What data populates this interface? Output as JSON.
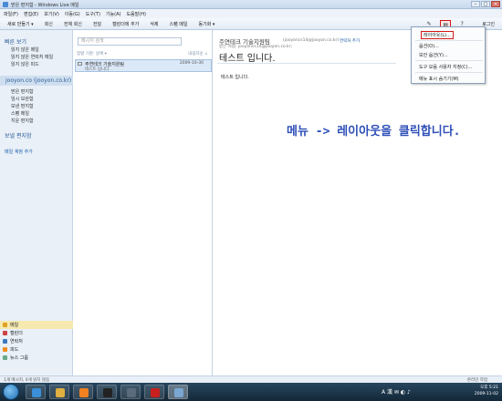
{
  "window": {
    "title": "받은 편지함 - Windows Live 메일",
    "controls": [
      "–",
      "□",
      "✕"
    ]
  },
  "menu": [
    "파일(F)",
    "편집(E)",
    "보기(V)",
    "이동(G)",
    "도구(T)",
    "기능(A)",
    "도움말(H)"
  ],
  "toolbar": {
    "items": [
      "새로 만들기 ▾",
      "회신",
      "전체 회신",
      "전달",
      "캘린더에 추가",
      "삭제",
      "스팸 메일",
      "동기화 ▾"
    ],
    "right": {
      "pen_icon": "✎",
      "layout_icon": "▤",
      "help_icon": "?",
      "login_label": "로그인"
    }
  },
  "sidebar": {
    "quick_view_header": "빠른 보기",
    "quick_items": [
      "읽지 않은 메일",
      "읽지 않은 연락처 메일",
      "읽지 않은 피드"
    ],
    "account": "jooyon.co (jooyon.co.kr)",
    "folders": [
      "받은 편지함",
      "임시 보관함",
      "보낸 편지함",
      "스팸 메일",
      "지운 편지함"
    ],
    "outbox": "보낼 편지함",
    "add_account": "메일 계정 추가",
    "bottom_nav": [
      {
        "label": "메일",
        "icon": "mail-icon",
        "color": "#e0a020",
        "selected": true
      },
      {
        "label": "캘린더",
        "icon": "calendar-icon",
        "color": "#c44",
        "selected": false
      },
      {
        "label": "연락처",
        "icon": "contacts-icon",
        "color": "#3a7abf",
        "selected": false
      },
      {
        "label": "피드",
        "icon": "feed-icon",
        "color": "#f08c1e",
        "selected": false
      },
      {
        "label": "뉴스 그룹",
        "icon": "newsgroup-icon",
        "color": "#6a8",
        "selected": false
      }
    ]
  },
  "message_list": {
    "search_placeholder": "메시지 검색",
    "sort_label": "정렬 기준: 날짜 ▾",
    "sort_order": "내림차순 ↓",
    "messages": [
      {
        "from": "주연테크 기술지원팀",
        "date": "2009-10-30",
        "subject": "테스트 입니다."
      }
    ]
  },
  "reading_pane": {
    "sender": "주연테크 기술지원팀",
    "sender_address": "(jooyoncs14@jooyon.co.kr)",
    "add_contact": "연락처 추가",
    "recipient": "받는 사람: jooyoncs14@jooyon.co.kr;",
    "subject": "테스트 입니다.",
    "body": "테스트 입니다."
  },
  "annotation": "메뉴 -> 레이아웃을 클릭합니다.",
  "dropdown": {
    "items": [
      "레이아웃(L)...",
      "옵션(O)...",
      "보안 옵션(Y)...",
      "도구 모음 사용자 지정(C)...",
      "메뉴 표시 숨기기(M)"
    ],
    "highlighted_index": 0
  },
  "status": {
    "left": "1개 메시지, 0개 읽지 않음",
    "right": "온라인 작업"
  },
  "taskbar": {
    "apps": [
      {
        "icon": "ie-icon",
        "color": "#3a8fd8"
      },
      {
        "icon": "explorer-icon",
        "color": "#e0b040"
      },
      {
        "icon": "media-player-icon",
        "color": "#f08020"
      },
      {
        "icon": "messenger-icon",
        "color": "#222222"
      },
      {
        "icon": "maxthon-icon",
        "color": "#5a6b7c"
      },
      {
        "icon": "flash-icon",
        "color": "#c8201e"
      },
      {
        "icon": "mail-app-icon",
        "color": "#7aa6d2"
      }
    ],
    "tray_chars": "A 漢 ✉ ◐ ♪",
    "time": "오후 5:21",
    "date": "2009-11-02"
  },
  "colors": {
    "annotation": "#2e4fb7",
    "highlight_box": "#d31616",
    "selected_row": "#dbe8f7"
  }
}
